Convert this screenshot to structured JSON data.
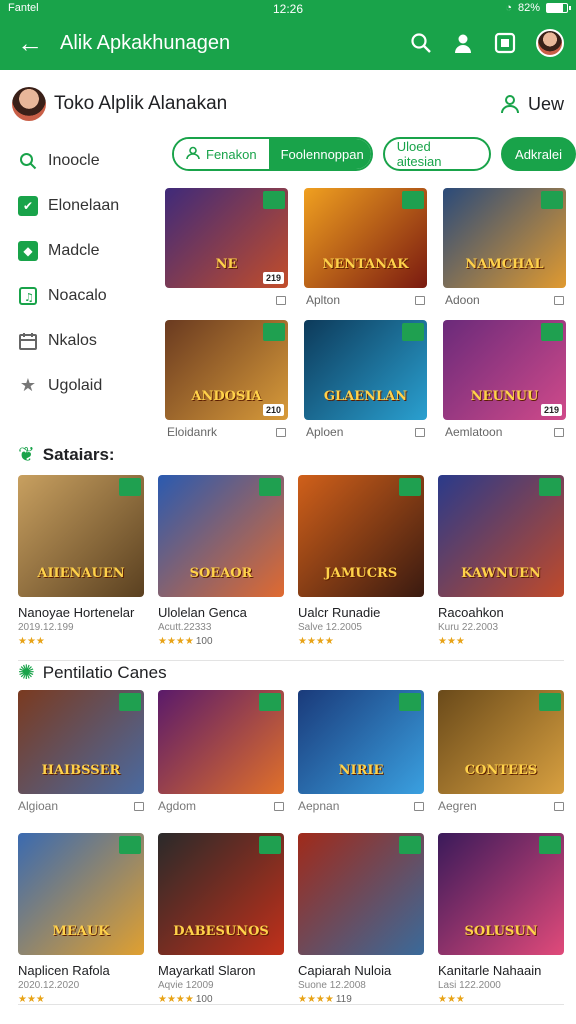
{
  "status": {
    "carrier": "Fantel",
    "time": "12:26",
    "battery": "82%",
    "battery_level": 0.82
  },
  "appbar": {
    "title": "Alik Apkakhunagen",
    "back_icon": "arrow-left-icon"
  },
  "store": {
    "name": "Toko Alplik Alanakan",
    "view_label": "Uew"
  },
  "sidebar": {
    "items": [
      {
        "label": "Inoocle",
        "icon": "search-icon"
      },
      {
        "label": "Elonelaan",
        "icon": "check-box-icon"
      },
      {
        "label": "Madcle",
        "icon": "cube-icon"
      },
      {
        "label": "Noacalo",
        "icon": "music-box-icon"
      },
      {
        "label": "Nkalos",
        "icon": "calendar-icon"
      },
      {
        "label": "Ugolaid",
        "icon": "star-icon"
      }
    ]
  },
  "chips": [
    {
      "label": "Fenakon"
    },
    {
      "label": "Foolennoppan"
    },
    {
      "label": "Uloed aitesian"
    },
    {
      "label": "Adkralei"
    }
  ],
  "topgrid": [
    {
      "caption": "",
      "art": "NE",
      "badge": "219",
      "colors": [
        "#3f2a7a",
        "#c24d2a"
      ]
    },
    {
      "caption": "Aplton",
      "art": "NENTANAK",
      "badge": "",
      "colors": [
        "#f0a020",
        "#7a1a10"
      ]
    },
    {
      "caption": "Adoon",
      "art": "NAMCHAL",
      "badge": "",
      "colors": [
        "#2a4a7a",
        "#e09a30"
      ]
    },
    {
      "caption": "Eloidanrk",
      "art": "ANDOSIA",
      "badge": "210",
      "colors": [
        "#6a3a20",
        "#d89b3a"
      ]
    },
    {
      "caption": "Aploen",
      "art": "GLAENLAN",
      "badge": "",
      "colors": [
        "#0d3a5a",
        "#2aa0d0"
      ]
    },
    {
      "caption": "Aemlatoon",
      "art": "NEUNUU",
      "badge": "219",
      "colors": [
        "#6a2a7a",
        "#d04a8a"
      ]
    }
  ],
  "section1": {
    "title": "Sataiars:",
    "games": [
      {
        "name": "Nanoyae Hortenelar",
        "sub": "2019.12.199",
        "stars": "★★★",
        "rating": "",
        "art": "AIIENAUEN",
        "colors": [
          "#c8a060",
          "#5a4020"
        ]
      },
      {
        "name": "Ulolelan Genca",
        "sub": "Acutt.22333",
        "stars": "★★★★",
        "rating": "100",
        "art": "SOEAOR",
        "colors": [
          "#2a5ab0",
          "#e06a30"
        ]
      },
      {
        "name": "Ualcr Runadie",
        "sub": "Salve 12.2005",
        "stars": "★★★★",
        "rating": "",
        "art": "JAMUCRS",
        "colors": [
          "#d0601a",
          "#3a1a10"
        ]
      },
      {
        "name": "Racoahkon",
        "sub": "Kuru 22.2003",
        "stars": "★★★",
        "rating": "",
        "art": "KAWNUEN",
        "colors": [
          "#2a3a8a",
          "#c04a2a"
        ]
      }
    ]
  },
  "section2": {
    "title": "Pentilatio Canes",
    "tiles": [
      {
        "caption": "Algioan",
        "art": "HAIBSSER",
        "colors": [
          "#7a3a20",
          "#4a6aa0"
        ]
      },
      {
        "caption": "Agdom",
        "art": "",
        "colors": [
          "#5a1a6a",
          "#e0702a"
        ]
      },
      {
        "caption": "Aepnan",
        "art": "NIRIE",
        "colors": [
          "#1a3a7a",
          "#3aa0e0"
        ]
      },
      {
        "caption": "Aegren",
        "art": "CONTEES",
        "colors": [
          "#6a4a1a",
          "#d8a040"
        ]
      }
    ],
    "games": [
      {
        "name": "Naplicen Rafola",
        "sub": "2020.12.2020",
        "stars": "★★★",
        "rating": "",
        "art": "MEAUK",
        "colors": [
          "#3a6ab0",
          "#e0a030"
        ]
      },
      {
        "name": "Mayarkatl Slaron",
        "sub": "Aqvie 12009",
        "stars": "★★★★",
        "rating": "100",
        "art": "DABESUNOS",
        "colors": [
          "#2a2a2a",
          "#c0301a"
        ]
      },
      {
        "name": "Capiarah Nuloia",
        "sub": "Suone 12.2008",
        "stars": "★★★★",
        "rating": "119",
        "art": "",
        "colors": [
          "#a02a1a",
          "#3a6a9a"
        ]
      },
      {
        "name": "Kanitarle Nahaain",
        "sub": "Lasi 122.2000",
        "stars": "★★★",
        "rating": "",
        "art": "SOLUSUN",
        "colors": [
          "#3a1a5a",
          "#e04a7a"
        ]
      }
    ]
  }
}
